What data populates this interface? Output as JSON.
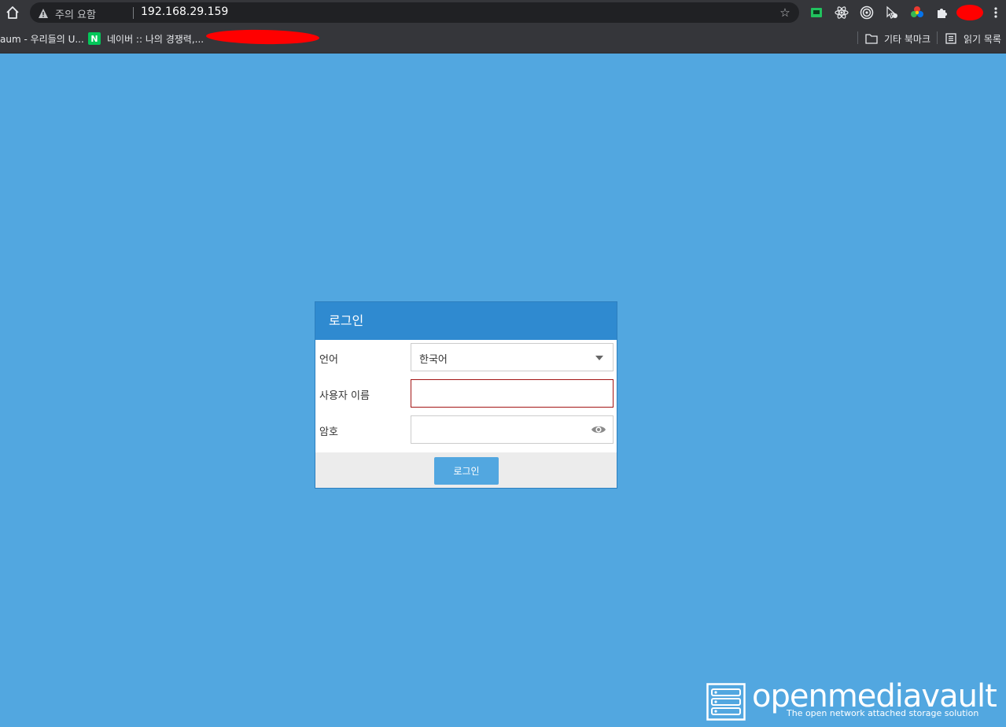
{
  "browser": {
    "security_label": "주의 요함",
    "url": "192.168.29.159",
    "icons": {
      "home": "home-icon",
      "warning": "warning-icon",
      "star": "star-icon",
      "extensions": [
        "ext-icon-1",
        "react-icon",
        "target-icon",
        "cursor-icon",
        "color-wheel-icon",
        "puzzle-icon",
        "profile-avatar",
        "menu-dots-icon"
      ]
    }
  },
  "bookmarks": {
    "items": [
      {
        "label": "aum - 우리들의 U..."
      },
      {
        "label": "네이버 :: 나의 경쟁력,...",
        "favicon": "N"
      }
    ],
    "other_bookmarks": "기타 북마크",
    "reading_list": "읽기 목록"
  },
  "login": {
    "title": "로그인",
    "language_label": "언어",
    "language_value": "한국어",
    "username_label": "사용자 이름",
    "username_value": "",
    "password_label": "암호",
    "password_value": "",
    "submit_label": "로그인"
  },
  "brand": {
    "name": "openmediavault",
    "tagline": "The open network attached storage solution"
  },
  "colors": {
    "background": "#52a7e0",
    "header": "#2f8ad0",
    "error_border": "#a31515",
    "footer": "#ececec"
  }
}
